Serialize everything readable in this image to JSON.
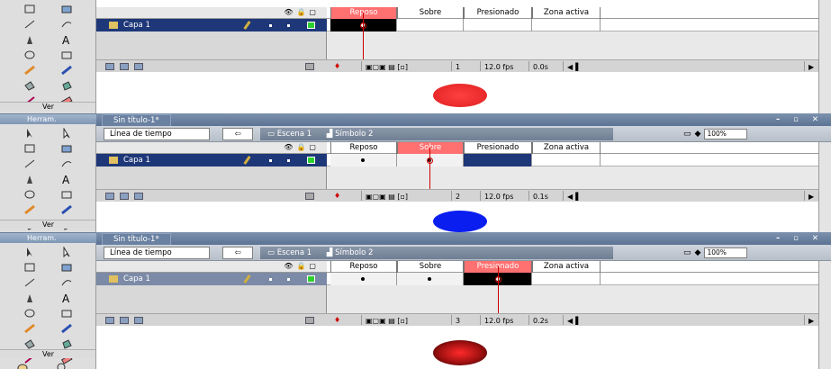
{
  "toolbox": {
    "label_ver": "Ver",
    "label_herramientas": "Herram."
  },
  "panels": [
    {
      "frame_labels": [
        "Reposo",
        "Sobre",
        "Presionado",
        "Zona activa"
      ],
      "active_frame": 0,
      "layer_name": "Capa 1",
      "frame_number": "1",
      "fps": "12.0 fps",
      "time": "0.0s",
      "symbol_color": "#e82020"
    },
    {
      "title": "Sin título-1*",
      "timeline_button": "Línea de tiempo",
      "scene": "Escena 1",
      "symbol": "Símbolo 2",
      "zoom": "100%",
      "frame_labels": [
        "Reposo",
        "Sobre",
        "Presionado",
        "Zona activa"
      ],
      "active_frame": 1,
      "layer_name": "Capa 1",
      "frame_number": "2",
      "fps": "12.0 fps",
      "time": "0.1s",
      "symbol_color": "#0a1ef0"
    },
    {
      "title": "Sin título-1*",
      "timeline_button": "Línea de tiempo",
      "scene": "Escena 1",
      "symbol": "Símbolo 2",
      "zoom": "100%",
      "frame_labels": [
        "Reposo",
        "Sobre",
        "Presionado",
        "Zona activa"
      ],
      "active_frame": 2,
      "layer_name": "Capa 1",
      "frame_number": "3",
      "fps": "12.0 fps",
      "time": "0.2s",
      "symbol_color": "#b01010"
    }
  ],
  "colors": {
    "active_frame_label": "#ff7070",
    "layer_selected": "#1e3778",
    "layer_dimmed": "#7b8aa6",
    "playhead": "#c00000"
  }
}
